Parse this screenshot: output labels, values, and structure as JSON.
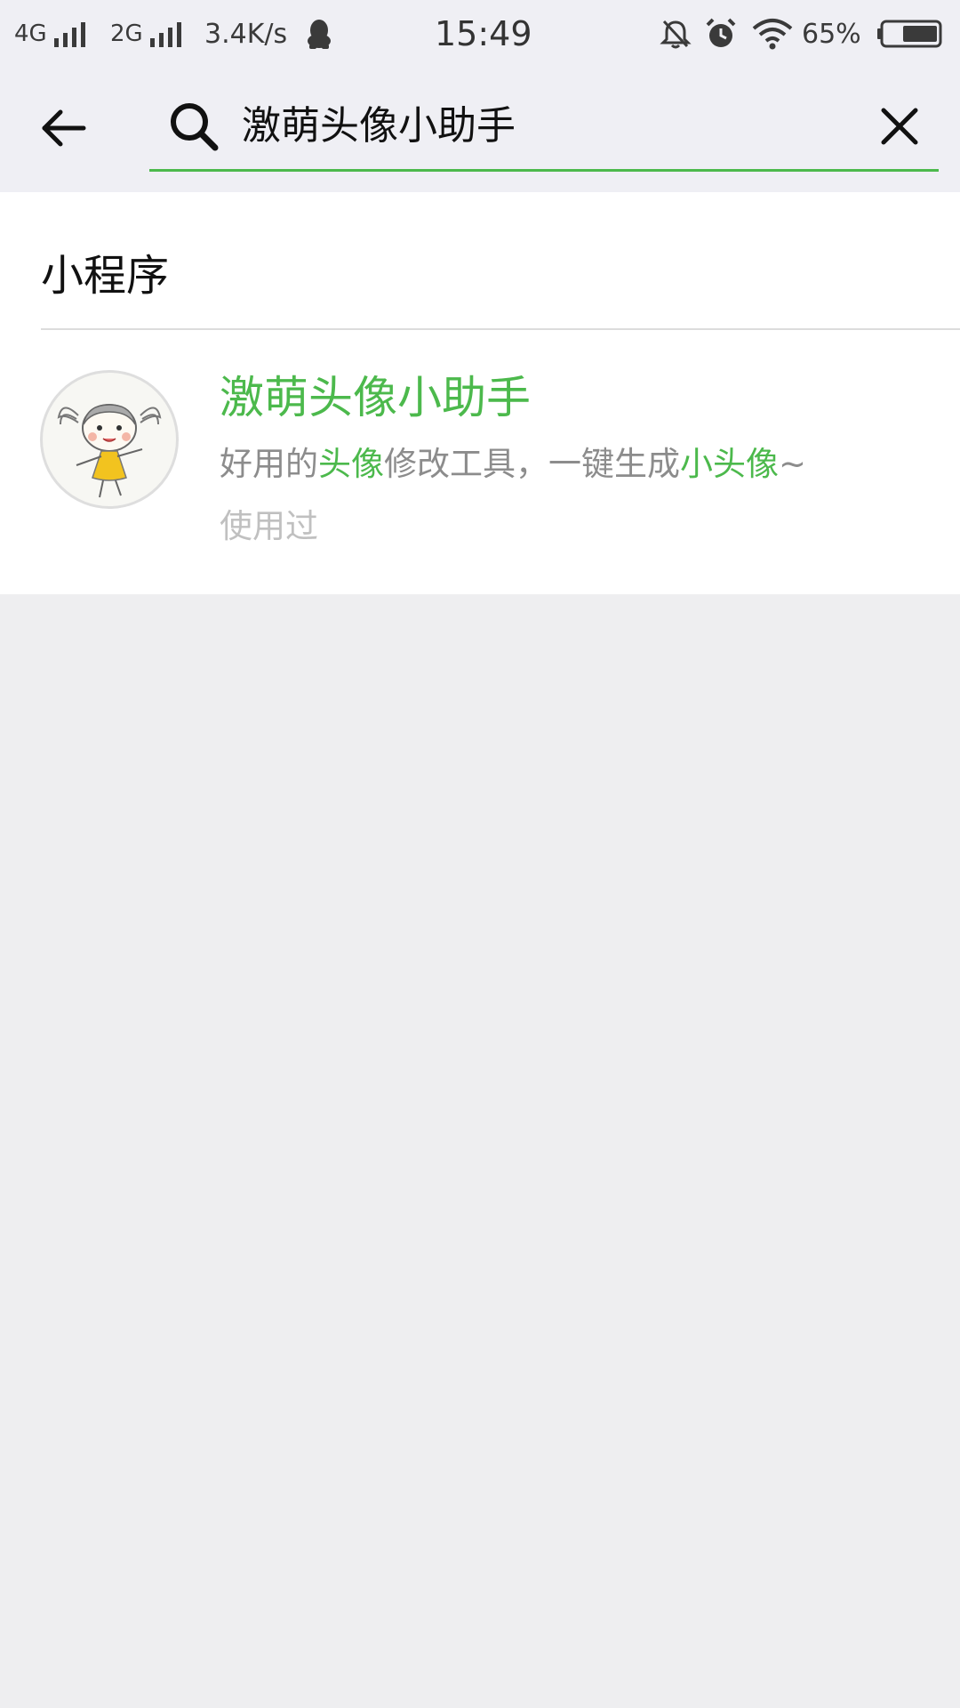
{
  "status_bar": {
    "network_1": "4G",
    "network_2": "2G",
    "speed": "3.4K/s",
    "time": "15:49",
    "battery": "65%",
    "icons": [
      "signal-icon",
      "qq-penguin-icon",
      "bell-muted-icon",
      "alarm-icon",
      "wifi-icon",
      "battery-icon"
    ]
  },
  "search": {
    "query": "激萌头像小助手",
    "back_icon": "back-arrow-icon",
    "search_icon": "search-icon",
    "clear_icon": "close-icon",
    "underline_color": "#4cb94c"
  },
  "results": {
    "section_title": "小程序",
    "items": [
      {
        "name": "激萌头像小助手",
        "description_parts": [
          {
            "text": "好用的",
            "highlight": false
          },
          {
            "text": "头像",
            "highlight": true
          },
          {
            "text": "修改工具，一键生成",
            "highlight": false
          },
          {
            "text": "小头像",
            "highlight": true
          },
          {
            "text": "~",
            "highlight": false
          }
        ],
        "tag": "使用过",
        "avatar_icon": "girl-cartoon-avatar"
      }
    ]
  },
  "colors": {
    "accent_green": "#4cb94c",
    "page_background": "#eeeef0",
    "header_background": "#efeff4",
    "secondary_text": "#8c8c8c",
    "tertiary_text": "#c0c0c0"
  }
}
